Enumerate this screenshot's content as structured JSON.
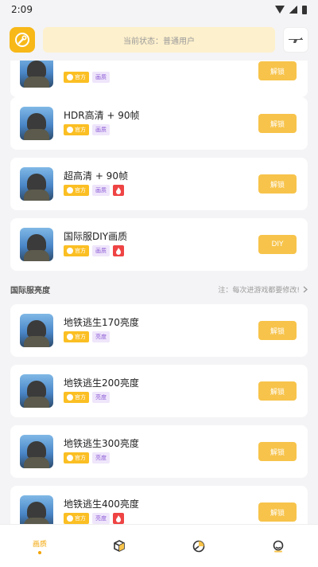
{
  "status_bar": {
    "time": "2:09"
  },
  "header": {
    "status_text": "当前状态：普通用户",
    "logo_icon": "wrench-badge-icon",
    "right_icon": "rifle-icon"
  },
  "cards_top": [
    {
      "title": "",
      "tags": [
        "官方",
        "画质"
      ],
      "hot": false,
      "button": "解锁"
    },
    {
      "title": "HDR高清 + 90帧",
      "tags": [
        "官方",
        "画质"
      ],
      "hot": false,
      "button": "解锁"
    },
    {
      "title": "超高清 + 90帧",
      "tags": [
        "官方",
        "画质"
      ],
      "hot": true,
      "button": "解锁"
    },
    {
      "title": "国际服DIY画质",
      "tags": [
        "官方",
        "画质"
      ],
      "hot": true,
      "button": "DIY"
    }
  ],
  "section": {
    "title": "国际服亮度",
    "note": "注：每次进游戏都要修改!"
  },
  "cards_bottom": [
    {
      "title": "地铁逃生170亮度",
      "tags": [
        "官方",
        "亮度"
      ],
      "hot": false,
      "button": "解锁"
    },
    {
      "title": "地铁逃生200亮度",
      "tags": [
        "官方",
        "亮度"
      ],
      "hot": false,
      "button": "解锁"
    },
    {
      "title": "地铁逃生300亮度",
      "tags": [
        "官方",
        "亮度"
      ],
      "hot": false,
      "button": "解锁"
    },
    {
      "title": "地铁逃生400亮度",
      "tags": [
        "官方",
        "亮度"
      ],
      "hot": true,
      "button": "解锁"
    }
  ],
  "tabbar": {
    "tabs": [
      {
        "label": "画质",
        "icon": "quality-icon",
        "active": true
      },
      {
        "label": "",
        "icon": "cube-icon",
        "active": false
      },
      {
        "label": "",
        "icon": "pie-chart-icon",
        "active": false
      },
      {
        "label": "",
        "icon": "profile-icon",
        "active": false
      }
    ]
  },
  "colors": {
    "accent": "#f7c34a",
    "accent_dark": "#f2a400",
    "hot": "#ef4444",
    "tag_purple": "#8c5bd6"
  }
}
